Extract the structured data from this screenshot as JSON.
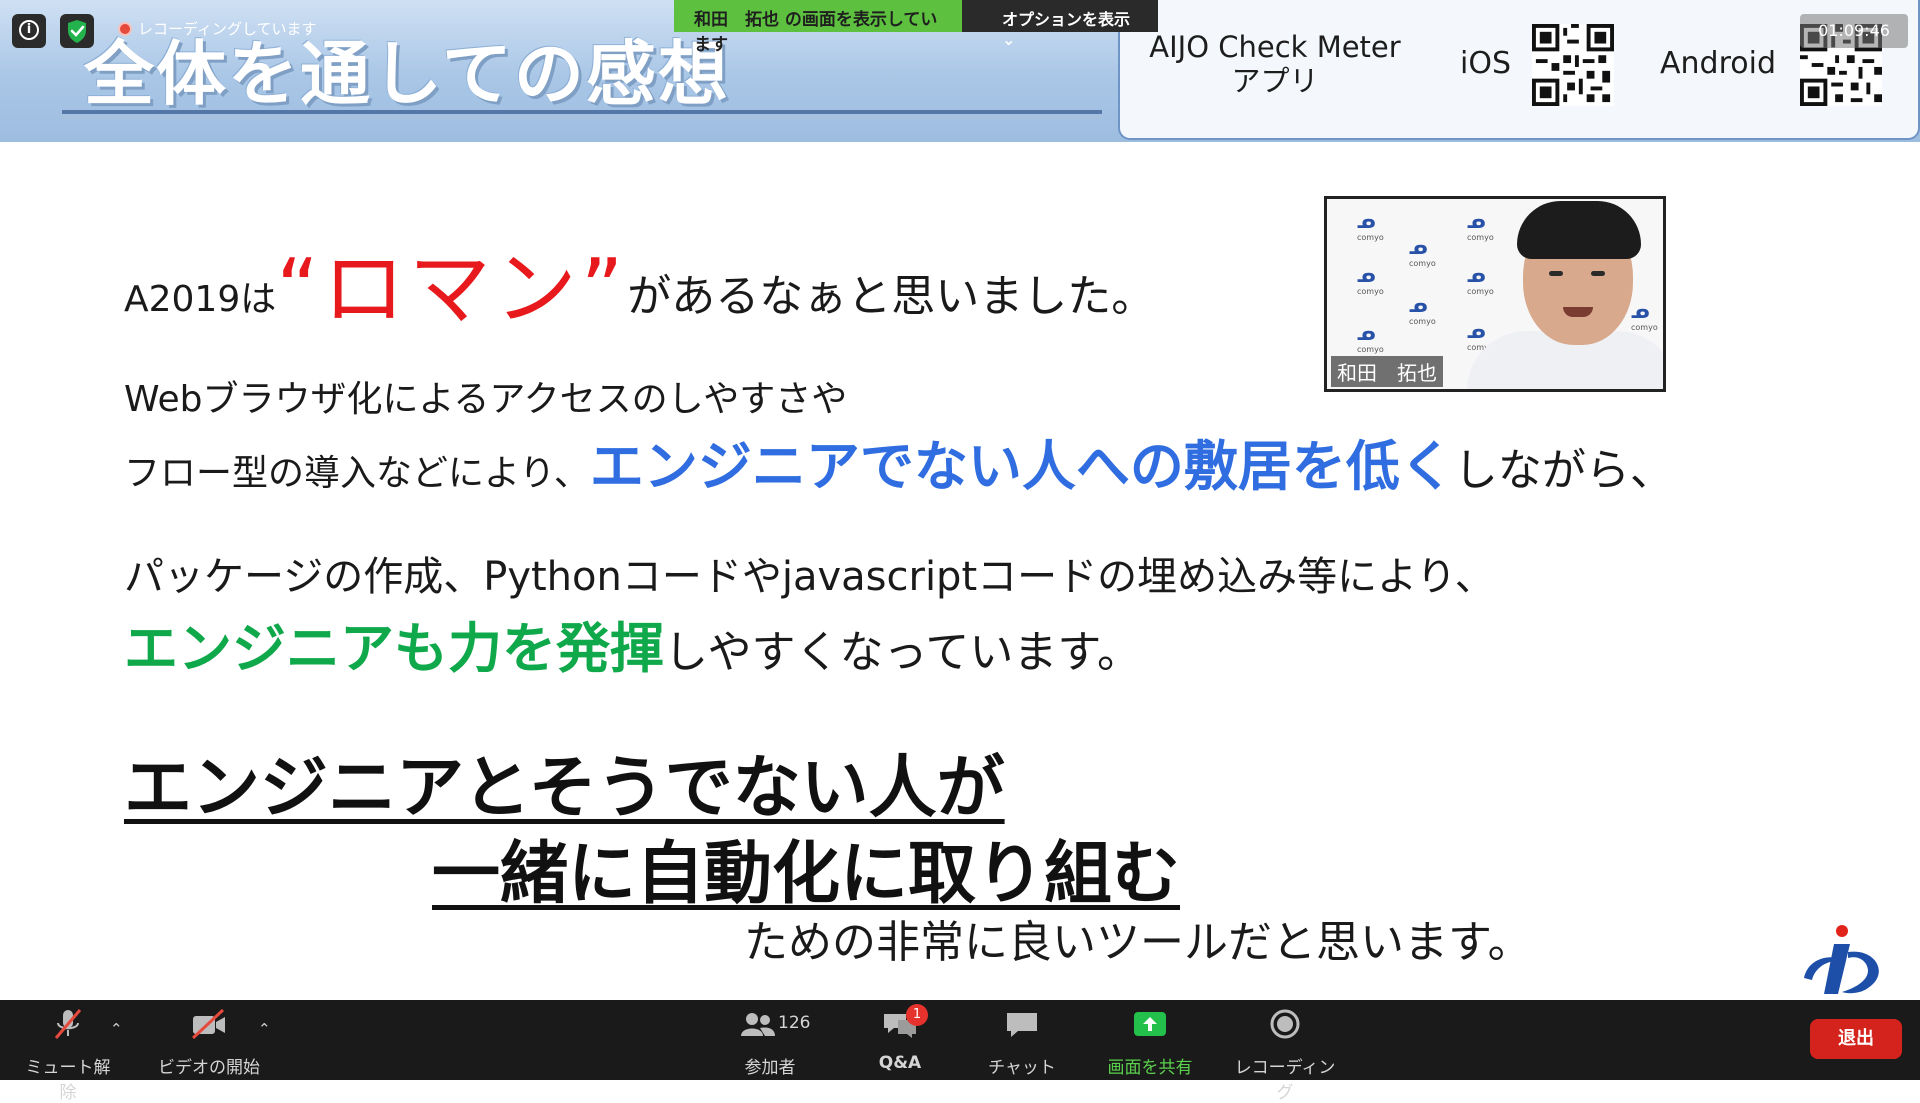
{
  "slide": {
    "title": "全体を通しての感想",
    "app_box": {
      "name_line1": "AIJO Check Meter",
      "name_line2": "アプリ",
      "ios_label": "iOS",
      "android_label": "Android"
    },
    "line1": {
      "prefix": "A2019は",
      "roman": "“ロマン”",
      "suffix": "があるなぁと思いました。"
    },
    "line2": "Webブラウザ化によるアクセスのしやすさや",
    "line3": {
      "prefix": "フロー型の導入などにより、",
      "highlight": "エンジニアでない人への敷居を低く",
      "suffix": "しながら、"
    },
    "line4": "パッケージの作成、Pythonコードやjavascriptコードの埋め込み等により、",
    "line5": {
      "highlight": "エンジニアも力を発揮",
      "suffix": "しやすくなっています。"
    },
    "big1": "エンジニアとそうでない人が",
    "big2": "一緒に自動化に取り組む",
    "closing": "ための非常に良いツールだと思います。"
  },
  "webcam": {
    "name": "和田　拓也",
    "logo_text": "comyo"
  },
  "overlay": {
    "recording": "レコーディングしています",
    "sharing_banner": "和田　拓也 の画面を表示しています",
    "options_label": "オプションを表示 ⌄",
    "timer": "01:09:46"
  },
  "toolbar": {
    "unmute": "ミュート解除",
    "start_video": "ビデオの開始",
    "participants": "参加者",
    "participants_count": "126",
    "qa": "Q&A",
    "qa_badge": "1",
    "chat": "チャット",
    "share": "画面を共有",
    "record": "レコーディング",
    "leave": "退出"
  },
  "colors": {
    "share_green": "#5dc13f",
    "leave_red": "#d4231c",
    "blue_text": "#2f6de0",
    "green_text": "#0fa84a",
    "red_text": "#e8191c"
  }
}
